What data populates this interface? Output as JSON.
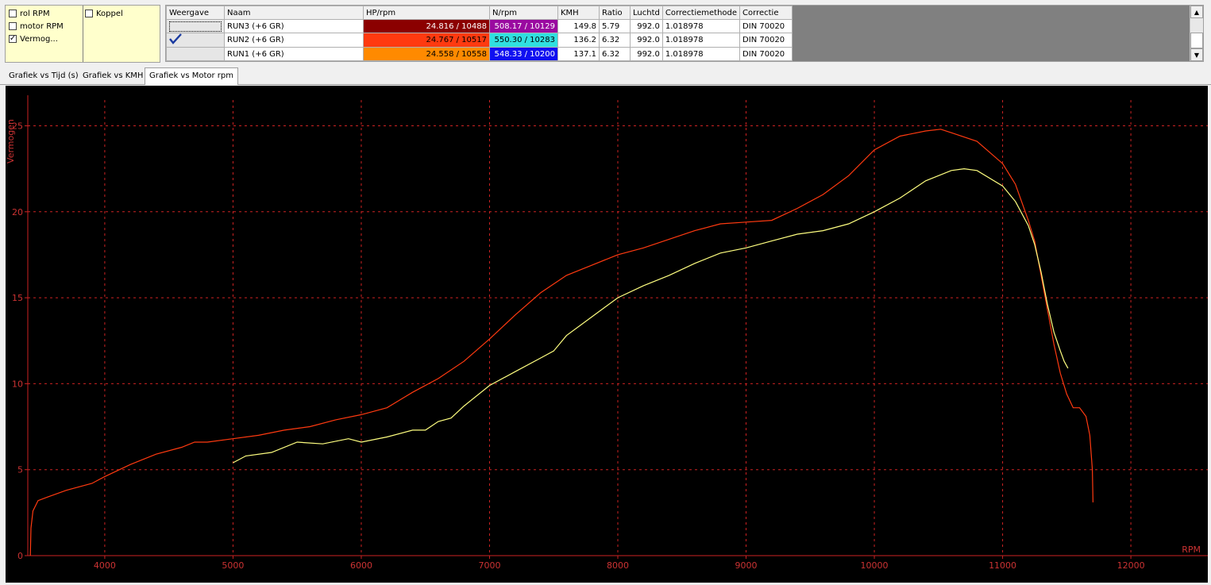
{
  "legend": {
    "checkboxes": [
      {
        "label": "rol RPM",
        "checked": false
      },
      {
        "label": "motor RPM",
        "checked": false
      },
      {
        "label": "Vermog...",
        "checked": true
      },
      {
        "label": "Koppel",
        "checked": false
      }
    ]
  },
  "runs_table": {
    "headers": [
      "Weergave",
      "Naam",
      "HP/rpm",
      "N/rpm",
      "KMH",
      "Ratio",
      "Luchtd",
      "Correctiemethode",
      "Correctie"
    ],
    "rows": [
      {
        "name": "RUN3 (+6 GR)",
        "hp": "24.816 / 10488",
        "hp_color": "#8b0000",
        "n": "508.17 / 10129",
        "n_color": "#9a0aa0",
        "kmh": "149.8",
        "ratio": "5.79",
        "luchtd": "992.0",
        "methode": "1.018978",
        "correctie": "DIN 70020",
        "shown": false
      },
      {
        "name": "RUN2 (+6 GR)",
        "hp": "24.767 / 10517",
        "hp_color": "#ff3a10",
        "n": "550.30 / 10283",
        "n_color": "#30e0e0",
        "kmh": "136.2",
        "ratio": "6.32",
        "luchtd": "992.0",
        "methode": "1.018978",
        "correctie": "DIN 70020",
        "shown": true
      },
      {
        "name": "RUN1 (+6 GR)",
        "hp": "24.558 / 10558",
        "hp_color": "#ff8a00",
        "n": "548.33 / 10200",
        "n_color": "#1010f0",
        "kmh": "137.1",
        "ratio": "6.32",
        "luchtd": "992.0",
        "methode": "1.018978",
        "correctie": "DIN 70020",
        "shown": false
      }
    ]
  },
  "tabs": [
    {
      "label": "Grafiek vs Tijd (s)",
      "active": false
    },
    {
      "label": "Grafiek vs KMH",
      "active": false
    },
    {
      "label": "Grafiek vs Motor rpm",
      "active": true
    }
  ],
  "chart_data": {
    "type": "line",
    "ylabel": "Vermogen",
    "xlabel": "RPM",
    "xlim": [
      3400,
      12600
    ],
    "ylim": [
      0,
      26.5
    ],
    "xticks": [
      4000,
      5000,
      6000,
      7000,
      8000,
      9000,
      10000,
      11000,
      12000
    ],
    "yticks": [
      0,
      5,
      10,
      15,
      20,
      25
    ],
    "grid": true,
    "background": "#000000",
    "grid_color": "#cc2222",
    "series": [
      {
        "color": "#ff3a10",
        "points": [
          [
            3420,
            0
          ],
          [
            3425,
            1.6
          ],
          [
            3440,
            2.6
          ],
          [
            3480,
            3.2
          ],
          [
            3550,
            3.4
          ],
          [
            3700,
            3.8
          ],
          [
            3900,
            4.2
          ],
          [
            4000,
            4.6
          ],
          [
            4200,
            5.3
          ],
          [
            4400,
            5.9
          ],
          [
            4600,
            6.3
          ],
          [
            4700,
            6.6
          ],
          [
            4800,
            6.6
          ],
          [
            5000,
            6.8
          ],
          [
            5200,
            7.0
          ],
          [
            5400,
            7.3
          ],
          [
            5600,
            7.5
          ],
          [
            5800,
            7.9
          ],
          [
            6000,
            8.2
          ],
          [
            6200,
            8.6
          ],
          [
            6400,
            9.5
          ],
          [
            6600,
            10.3
          ],
          [
            6800,
            11.3
          ],
          [
            7000,
            12.6
          ],
          [
            7200,
            14.0
          ],
          [
            7400,
            15.3
          ],
          [
            7600,
            16.3
          ],
          [
            7800,
            16.9
          ],
          [
            8000,
            17.5
          ],
          [
            8200,
            17.9
          ],
          [
            8400,
            18.4
          ],
          [
            8600,
            18.9
          ],
          [
            8800,
            19.3
          ],
          [
            9000,
            19.4
          ],
          [
            9200,
            19.5
          ],
          [
            9400,
            20.2
          ],
          [
            9600,
            21.0
          ],
          [
            9800,
            22.1
          ],
          [
            10000,
            23.6
          ],
          [
            10200,
            24.4
          ],
          [
            10400,
            24.7
          ],
          [
            10517,
            24.8
          ],
          [
            10600,
            24.6
          ],
          [
            10800,
            24.1
          ],
          [
            11000,
            22.8
          ],
          [
            11100,
            21.6
          ],
          [
            11200,
            19.5
          ],
          [
            11250,
            18.3
          ],
          [
            11300,
            16.3
          ],
          [
            11350,
            14.3
          ],
          [
            11400,
            12.3
          ],
          [
            11450,
            10.6
          ],
          [
            11500,
            9.4
          ],
          [
            11550,
            8.6
          ],
          [
            11600,
            8.6
          ],
          [
            11650,
            8.1
          ],
          [
            11680,
            7.0
          ],
          [
            11700,
            5.0
          ],
          [
            11705,
            3.1
          ]
        ]
      },
      {
        "color": "#ffff80",
        "points": [
          [
            5000,
            5.4
          ],
          [
            5100,
            5.8
          ],
          [
            5300,
            6.0
          ],
          [
            5500,
            6.6
          ],
          [
            5700,
            6.5
          ],
          [
            5900,
            6.8
          ],
          [
            6000,
            6.6
          ],
          [
            6200,
            6.9
          ],
          [
            6400,
            7.3
          ],
          [
            6500,
            7.3
          ],
          [
            6600,
            7.8
          ],
          [
            6700,
            8.0
          ],
          [
            6800,
            8.7
          ],
          [
            7000,
            9.9
          ],
          [
            7200,
            10.7
          ],
          [
            7400,
            11.5
          ],
          [
            7500,
            11.9
          ],
          [
            7600,
            12.8
          ],
          [
            7800,
            13.9
          ],
          [
            8000,
            15.0
          ],
          [
            8200,
            15.7
          ],
          [
            8400,
            16.3
          ],
          [
            8600,
            17.0
          ],
          [
            8800,
            17.6
          ],
          [
            9000,
            17.9
          ],
          [
            9200,
            18.3
          ],
          [
            9400,
            18.7
          ],
          [
            9600,
            18.9
          ],
          [
            9800,
            19.3
          ],
          [
            10000,
            20.0
          ],
          [
            10200,
            20.8
          ],
          [
            10400,
            21.8
          ],
          [
            10600,
            22.4
          ],
          [
            10700,
            22.5
          ],
          [
            10800,
            22.4
          ],
          [
            11000,
            21.5
          ],
          [
            11100,
            20.6
          ],
          [
            11200,
            19.2
          ],
          [
            11250,
            18.1
          ],
          [
            11300,
            16.5
          ],
          [
            11350,
            14.6
          ],
          [
            11400,
            13.0
          ],
          [
            11450,
            11.9
          ],
          [
            11480,
            11.3
          ],
          [
            11510,
            10.9
          ]
        ]
      }
    ]
  }
}
